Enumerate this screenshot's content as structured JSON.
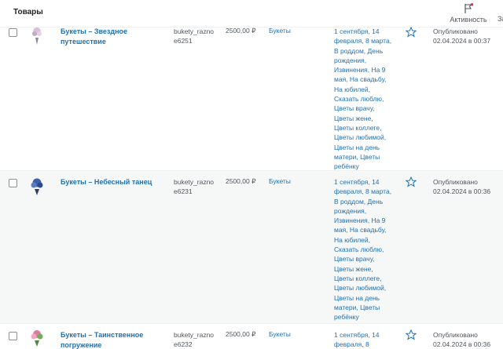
{
  "header": {
    "title": "Товары",
    "activity_label": "Активность",
    "next_label": "За"
  },
  "colors": {
    "link": "#2271b1",
    "text": "#50575e",
    "notification_dot": "#d63638"
  },
  "rows": [
    {
      "name": "Букеты – Звездное путешествие",
      "sku": "bukety_raznoe6251",
      "price": "2500,00 ₽",
      "category": "Букеты",
      "tags": "1 сентября, 14 февраля, 8 марта, В роддом, День рождения, Извинения, На 9 мая, На свадьбу, На юбилей, Сказать люблю, Цветы врачу, Цветы жене, Цветы коллеге, Цветы любимой, Цветы на день матери, Цветы ребёнку",
      "featured_icon": "star-outline-icon",
      "status": "Опубликовано",
      "date": "02.04.2024 в 00:37"
    },
    {
      "name": "Букеты – Небесный танец",
      "sku": "bukety_raznoe6231",
      "price": "2500,00 ₽",
      "category": "Букеты",
      "tags": "1 сентября, 14 февраля, 8 марта, В роддом, День рождения, Извинения, На 9 мая, На свадьбу, На юбилей, Сказать люблю, Цветы врачу, Цветы жене, Цветы коллеге, Цветы любимой, Цветы на день матери, Цветы ребёнку",
      "featured_icon": "star-outline-icon",
      "status": "Опубликовано",
      "date": "02.04.2024 в 00:36"
    },
    {
      "name": "Букеты – Таинственное погружение",
      "sku": "bukety_raznoe6232",
      "price": "2500,00 ₽",
      "category": "Букеты",
      "tags": "1 сентября, 14 февраля, 8",
      "featured_icon": "star-outline-icon",
      "status": "Опубликовано",
      "date": "02.04.2024 в 00:36"
    }
  ]
}
